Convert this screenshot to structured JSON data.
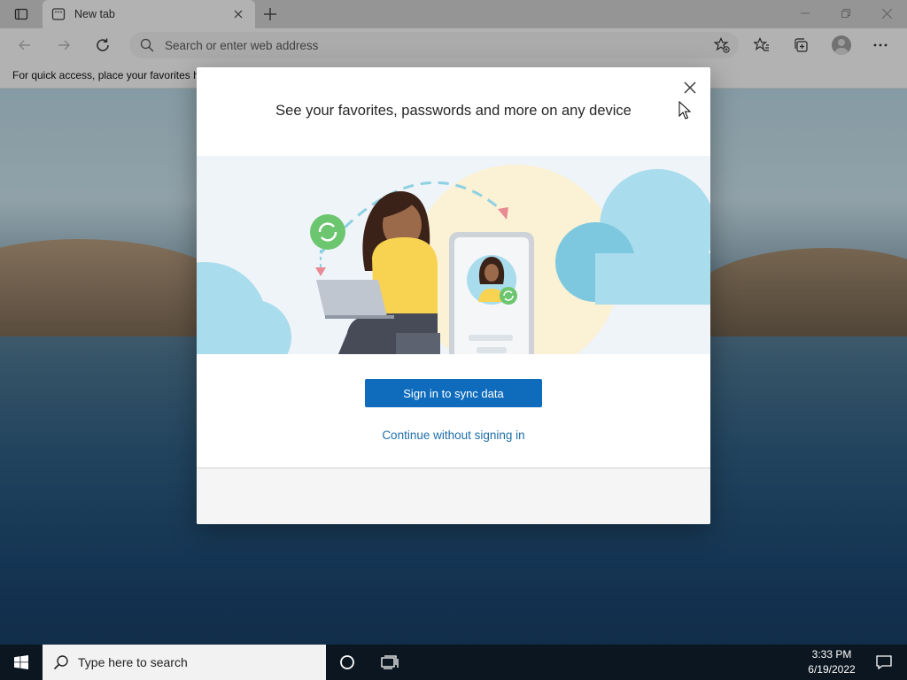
{
  "browser": {
    "tab_title": "New tab",
    "address_placeholder": "Search or enter web address",
    "favorites_bar_text": "For quick access, place your favorites here on the favorites bar."
  },
  "dialog": {
    "title": "See your favorites, passwords and more on any device",
    "primary_button": "Sign in to sync data",
    "secondary_link": "Continue without signing in"
  },
  "taskbar": {
    "search_placeholder": "Type here to search",
    "time": "3:33 PM",
    "date": "6/19/2022"
  },
  "colors": {
    "accent": "#0f6cbd",
    "link": "#1f6fa8",
    "taskbar": "#0c1620"
  },
  "icons": [
    "tab-actions-icon",
    "new-tab-page-icon",
    "close-icon",
    "plus-icon",
    "minimize-icon",
    "maximize-icon",
    "back-icon",
    "forward-icon",
    "refresh-icon",
    "search-icon",
    "add-favorite-icon",
    "favorites-icon",
    "collections-icon",
    "profile-icon",
    "more-icon",
    "windows-logo-icon",
    "task-view-icon",
    "cortana-icon",
    "notification-icon"
  ]
}
